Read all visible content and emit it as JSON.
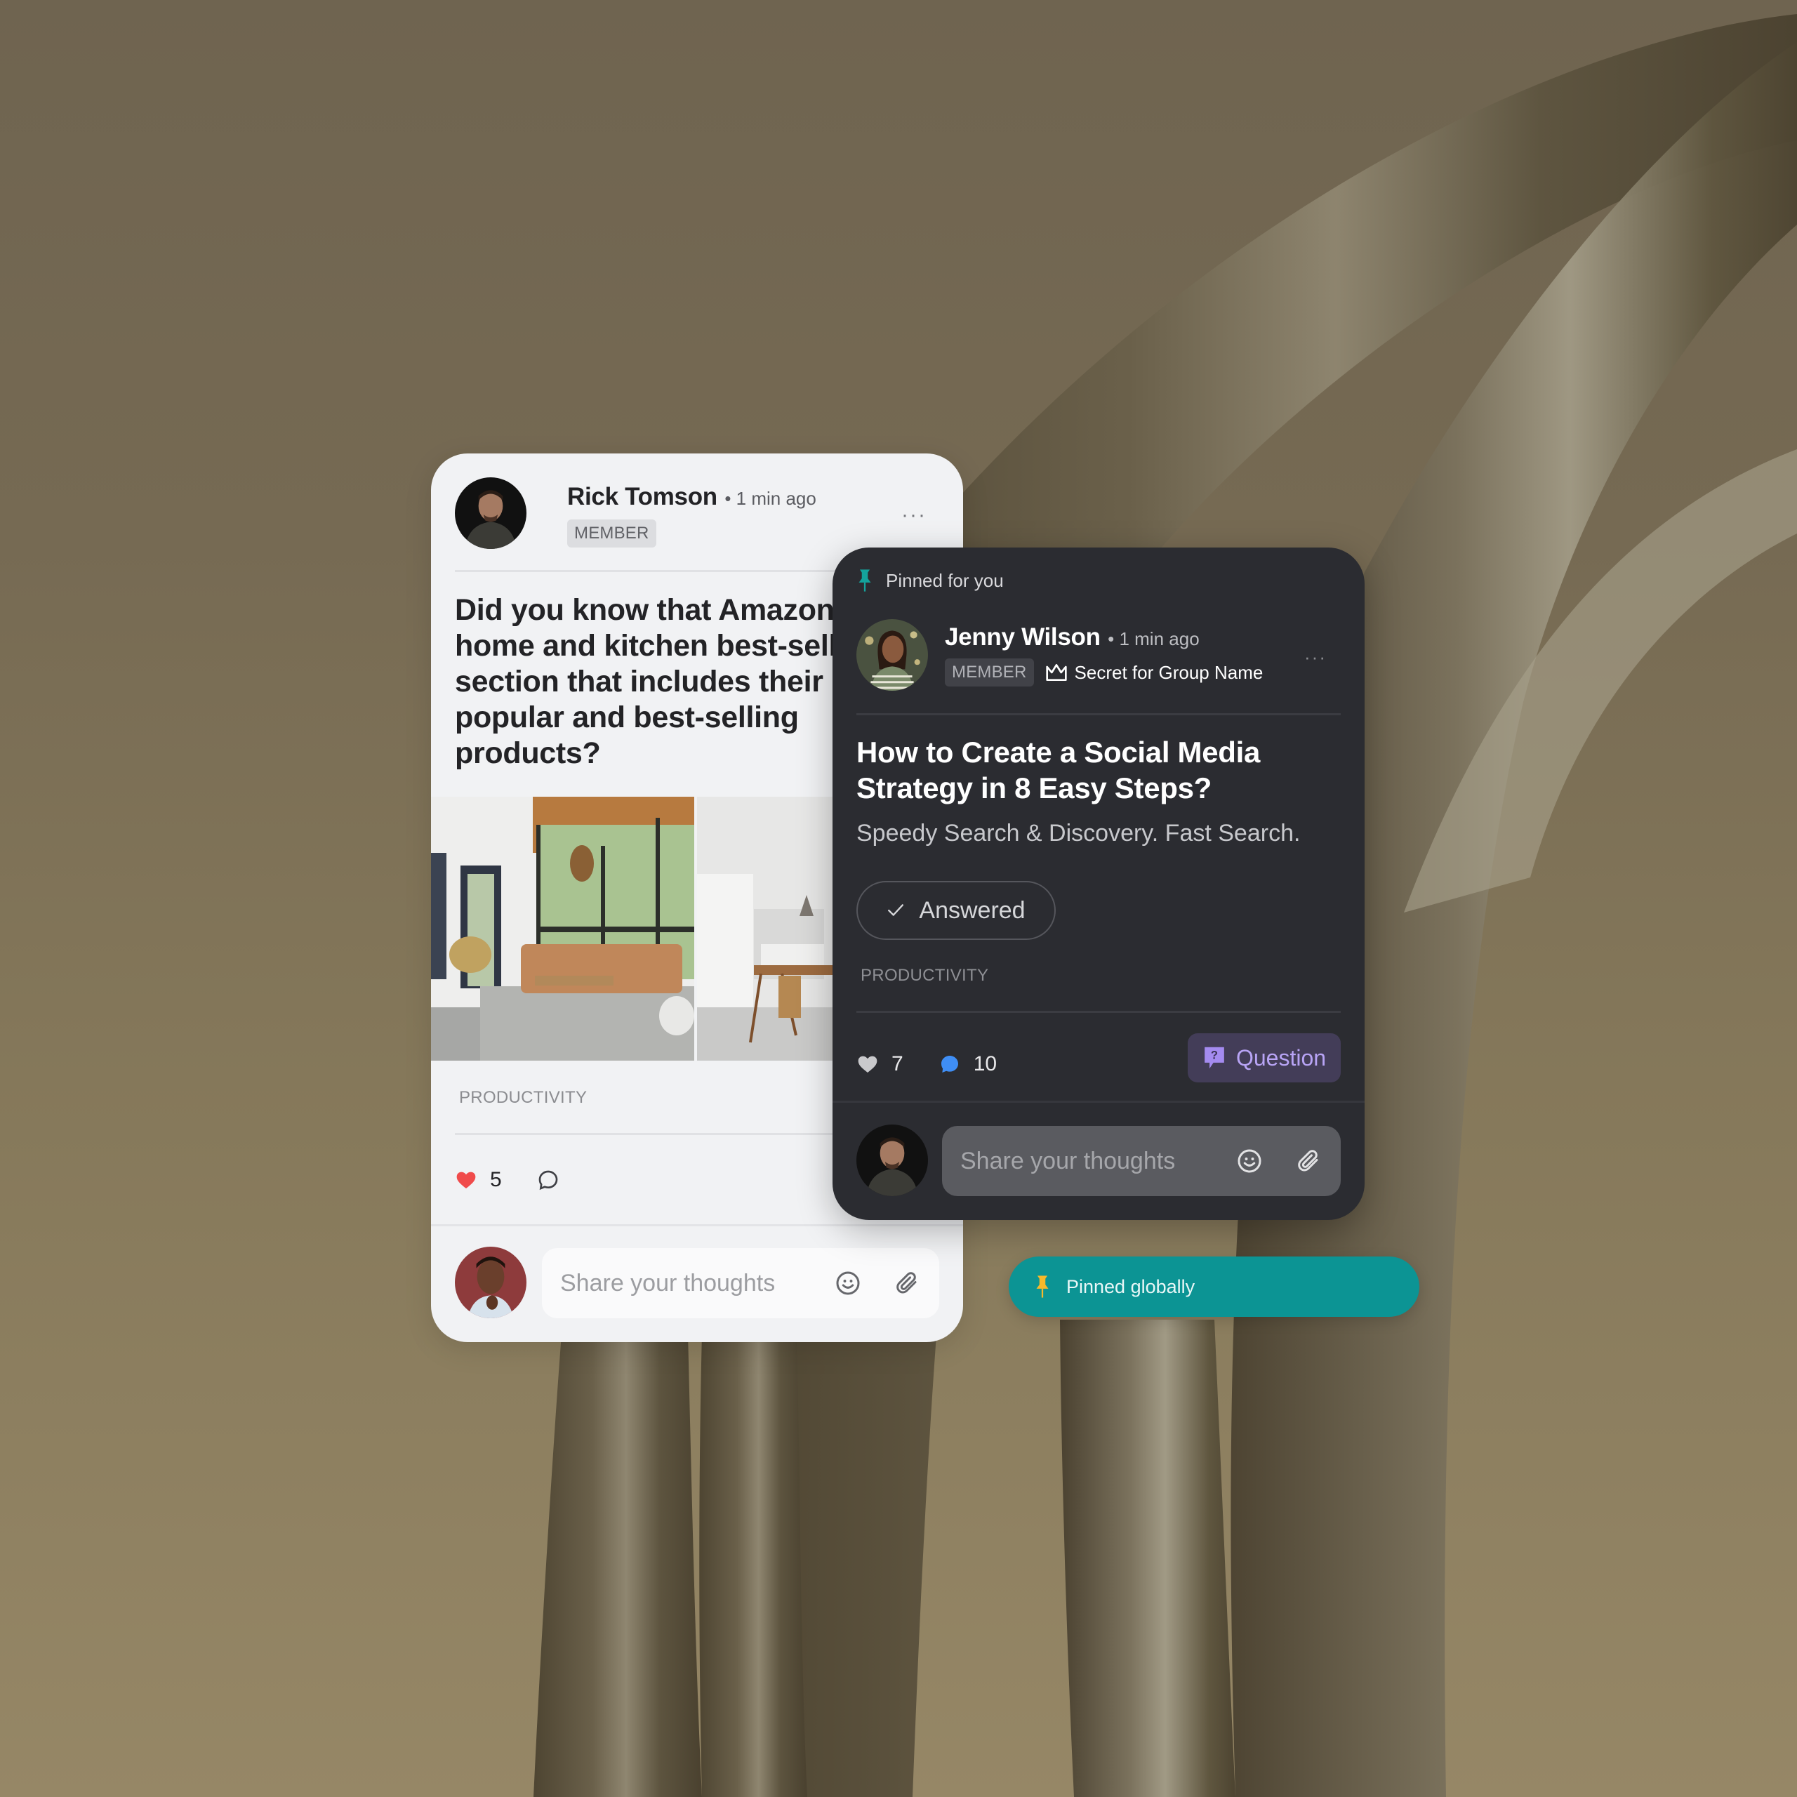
{
  "colors": {
    "accent_teal": "#0c9494",
    "heart_red": "#f04b4b",
    "comment_blue": "#3f8ef5",
    "question_purple": "#b8a4f5",
    "pin_yellow": "#f6b92b",
    "dark_card_bg": "#2b2c31",
    "light_card_bg": "#f1f2f4"
  },
  "post_light": {
    "author": {
      "name": "Rick Tomson",
      "time": "• 1 min ago",
      "role_badge": "MEMBER",
      "avatar_icon": "avatar-man"
    },
    "more_label": "···",
    "title": "Did you know that Amazon has a home and kitchen best-sellers section that includes their most popular and best-selling products?",
    "images": [
      "living-room-photo",
      "kitchen-dining-photo"
    ],
    "tag": "PRODUCTIVITY",
    "reactions": {
      "likes": "5",
      "liked": true,
      "comments": ""
    },
    "composer": {
      "placeholder": "Share your thoughts",
      "value": "",
      "avatar_icon": "avatar-woman",
      "emoji_icon": "smiley-icon",
      "attach_icon": "paperclip-icon"
    }
  },
  "post_dark": {
    "pinned_label": "Pinned for you",
    "author": {
      "name": "Jenny Wilson",
      "time": "• 1 min ago",
      "role_badge": "MEMBER",
      "group_label": "Secret for Group Name",
      "avatar_icon": "avatar-woman-outdoor"
    },
    "more_label": "···",
    "title": "How to Create a Social Media Strategy in 8 Easy Steps?",
    "subtitle": "Speedy Search & Discovery. Fast Search.",
    "answered_label": "Answered",
    "tag": "PRODUCTIVITY",
    "reactions": {
      "likes": "7",
      "liked": false,
      "comments": "10"
    },
    "type_badge": "Question",
    "composer": {
      "placeholder": "Share your thoughts",
      "value": "",
      "avatar_icon": "avatar-man",
      "emoji_icon": "smiley-icon",
      "attach_icon": "paperclip-icon"
    }
  },
  "pinned_global": {
    "label": "Pinned globally"
  }
}
